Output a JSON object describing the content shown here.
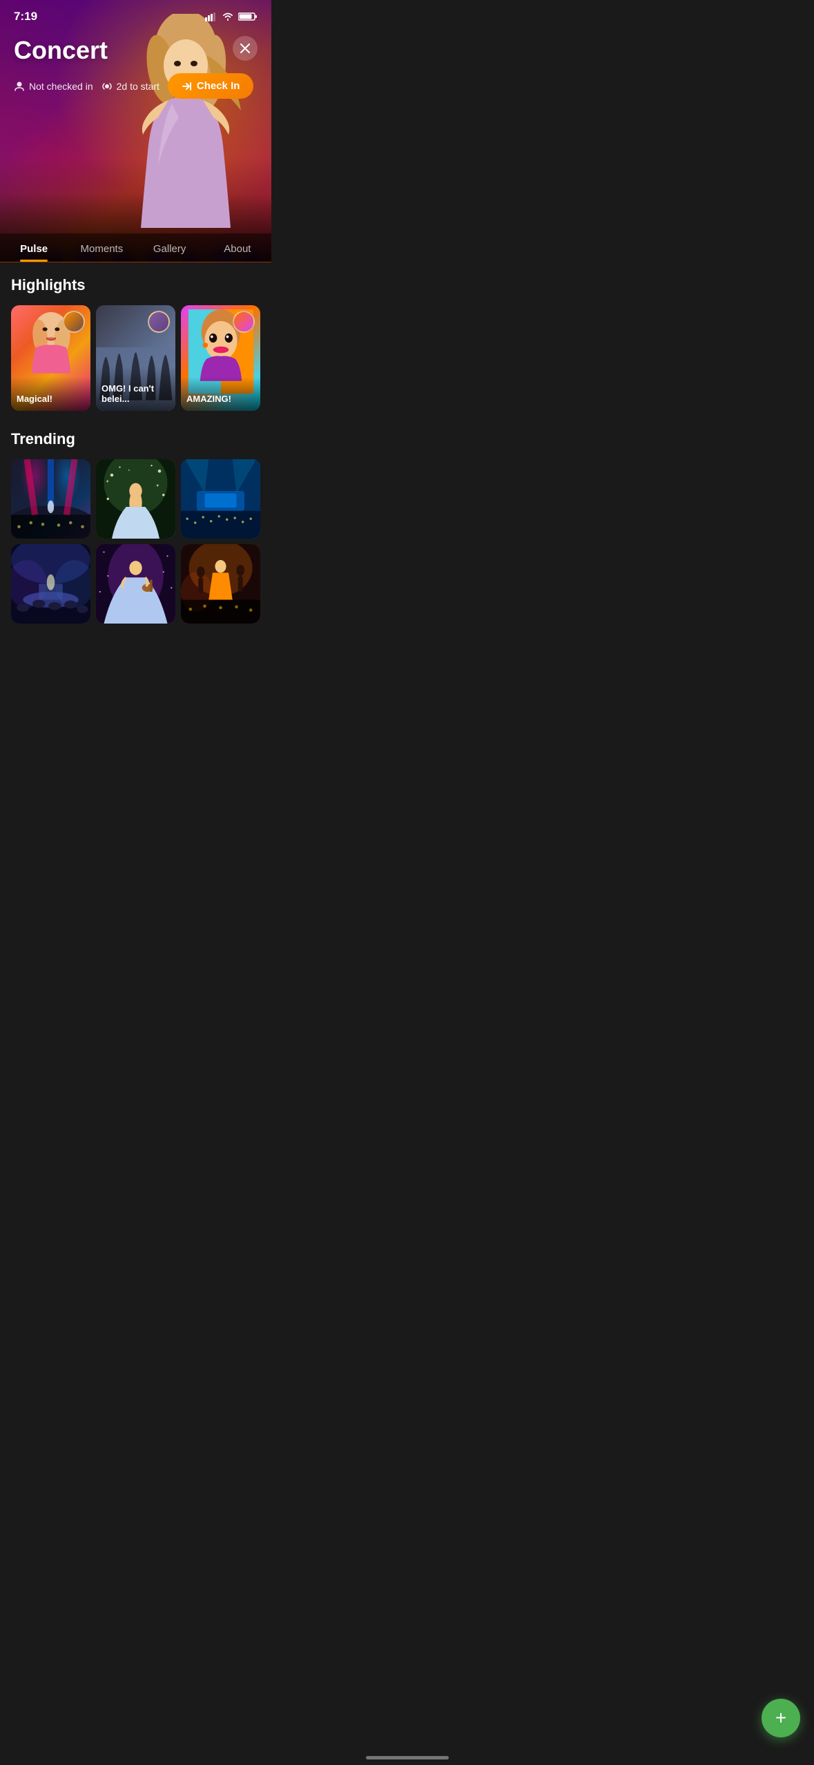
{
  "statusBar": {
    "time": "7:19",
    "signal": "▲▲▲",
    "wifi": "wifi",
    "battery": "battery"
  },
  "hero": {
    "title": "Concert",
    "closeLabel": "×",
    "statusItems": [
      {
        "icon": "👤",
        "text": "Not checked in"
      },
      {
        "icon": "📡",
        "text": "2d to start"
      }
    ],
    "checkInButton": "Check In",
    "checkInIcon": "→"
  },
  "tabs": [
    {
      "id": "pulse",
      "label": "Pulse",
      "active": true
    },
    {
      "id": "moments",
      "label": "Moments",
      "active": false
    },
    {
      "id": "gallery",
      "label": "Gallery",
      "active": false
    },
    {
      "id": "about",
      "label": "About",
      "active": false
    }
  ],
  "highlights": {
    "sectionTitle": "Highlights",
    "items": [
      {
        "id": 1,
        "caption": "Magical!"
      },
      {
        "id": 2,
        "caption": "OMG! I can't belei..."
      },
      {
        "id": 3,
        "caption": "AMAZING!"
      }
    ]
  },
  "trending": {
    "sectionTitle": "Trending",
    "items": [
      {
        "id": 1
      },
      {
        "id": 2
      },
      {
        "id": 3
      },
      {
        "id": 4
      },
      {
        "id": 5
      },
      {
        "id": 6
      }
    ]
  },
  "fab": {
    "icon": "+",
    "label": "Add post"
  },
  "colors": {
    "accent": "#ff9800",
    "fabGreen": "#4caf50",
    "tabActive": "#ffffff",
    "tabInactive": "rgba(255,255,255,0.7)"
  }
}
